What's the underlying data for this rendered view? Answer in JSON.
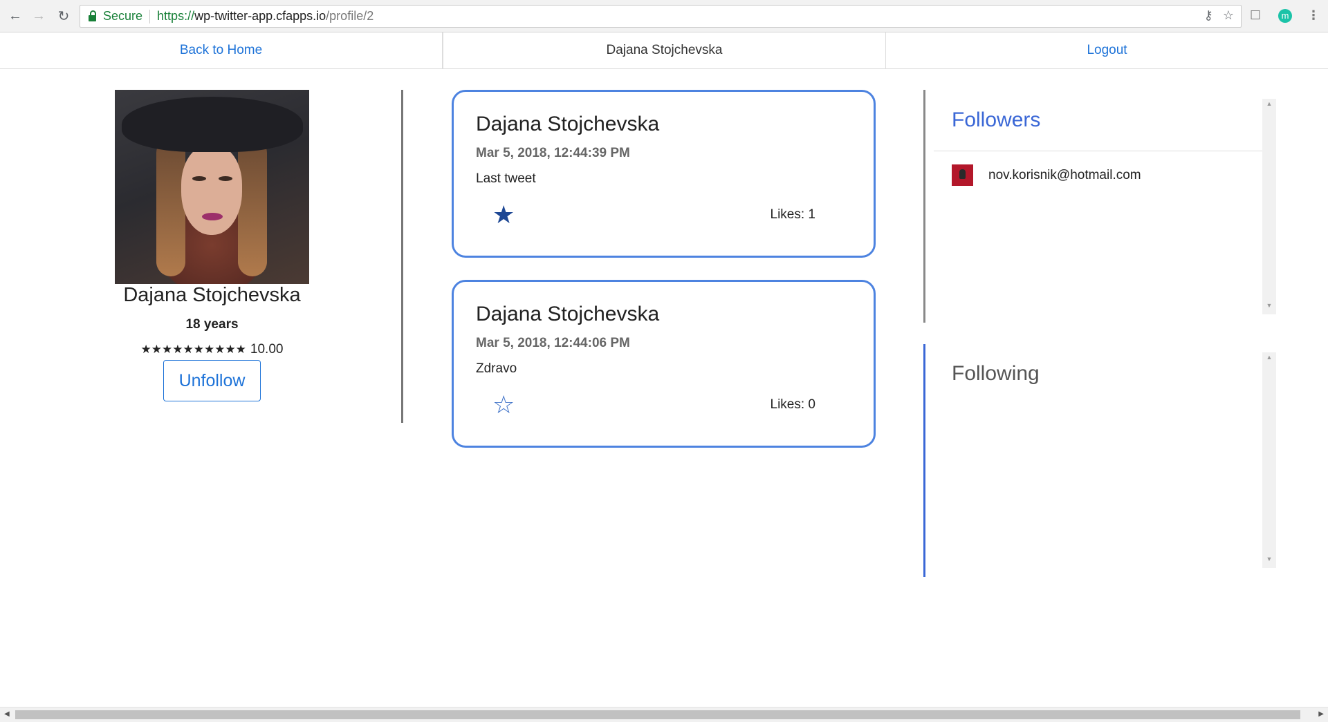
{
  "browser": {
    "secure_label": "Secure",
    "url_scheme": "https://",
    "url_host": "wp-twitter-app.cfapps.io",
    "url_path": "/profile/2",
    "extension_letter": "m"
  },
  "nav": {
    "back_home": "Back to Home",
    "current_user": "Dajana Stojchevska",
    "logout": "Logout"
  },
  "profile": {
    "name": "Dajana Stojchevska",
    "age": "18 years",
    "stars": "★★★★★★★★★★",
    "rating": "10.00",
    "unfollow": "Unfollow"
  },
  "tweets": [
    {
      "author": "Dajana Stojchevska",
      "date": "Mar 5, 2018, 12:44:39 PM",
      "text": "Last tweet",
      "likes": "Likes: 1",
      "liked": true
    },
    {
      "author": "Dajana Stojchevska",
      "date": "Mar 5, 2018, 12:44:06 PM",
      "text": "Zdravo",
      "likes": "Likes: 0",
      "liked": false
    }
  ],
  "followers": {
    "title": "Followers",
    "items": [
      {
        "email": "nov.korisnik@hotmail.com"
      }
    ]
  },
  "following": {
    "title": "Following"
  },
  "colors": {
    "link": "#1e73d8",
    "tweet_border": "#4d83e0",
    "star_filled": "#1d4794",
    "followers_title": "#3a67d6",
    "following_title": "#555555"
  },
  "icons": {
    "back": "arrow-left-icon",
    "forward": "arrow-right-icon",
    "reload": "reload-icon",
    "lock": "lock-icon",
    "key": "key-icon",
    "bookmark": "star-icon",
    "menu": "kebab-menu-icon"
  }
}
